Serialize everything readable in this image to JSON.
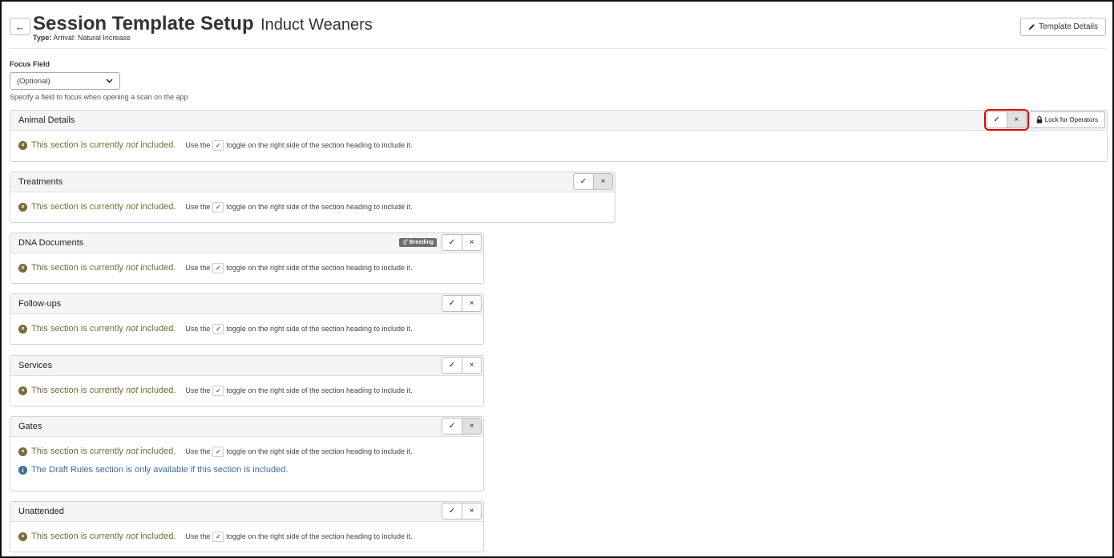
{
  "header": {
    "back_icon": "←",
    "title": "Session Template Setup",
    "subtitle": "Induct Weaners",
    "type_label": "Type:",
    "type_value": "Arrival: Natural Increase",
    "template_details_label": "Template Details",
    "template_details_icon": "pencil-icon"
  },
  "focus": {
    "label": "Focus Field",
    "selected": "(Optional)",
    "help": "Specify a field to focus when opening a scan on the app"
  },
  "messages": {
    "not_included_pre": "This section is currently ",
    "not_included_em": "not",
    "not_included_post": " included.",
    "use_the": "Use the",
    "toggle_rest": "toggle on the right side of the section heading to include it.",
    "check_glyph": "✓",
    "x_glyph": "×",
    "info_glyph": "i"
  },
  "toggle_glyphs": {
    "include": "✓",
    "exclude": "×"
  },
  "lock_label": "Lock for Operators",
  "sections": [
    {
      "title": "Animal Details"
    },
    {
      "title": "Treatments"
    },
    {
      "title": "DNA Documents",
      "badge": "Breeding"
    },
    {
      "title": "Follow-ups"
    },
    {
      "title": "Services"
    },
    {
      "title": "Gates",
      "info": "The Draft Rules section is only available if this section is included."
    },
    {
      "title": "Unattended"
    }
  ],
  "colors": {
    "not_included": "#7a6a3a",
    "info": "#3a6e9e",
    "highlight": "#e00000"
  }
}
